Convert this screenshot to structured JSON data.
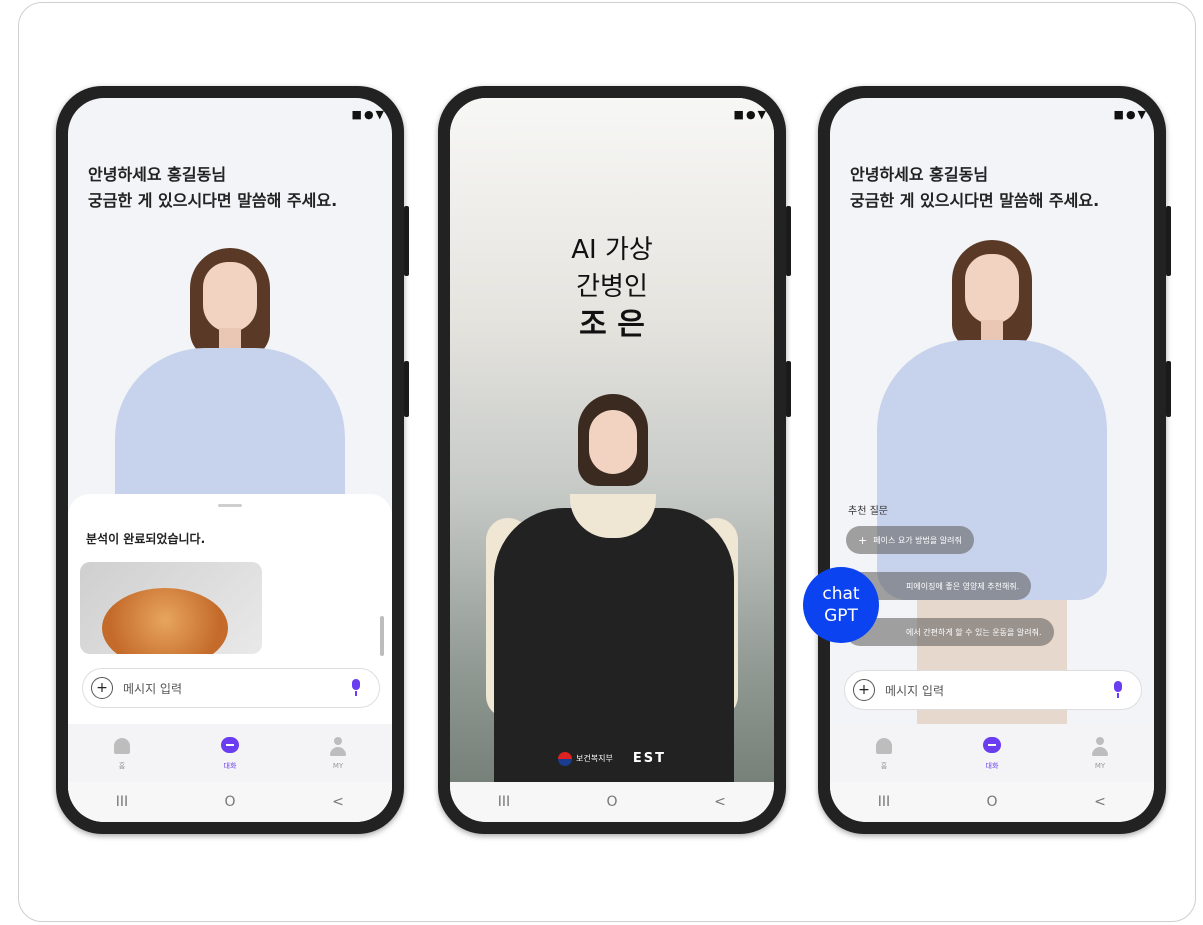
{
  "status_icons": "■●▼",
  "left_phone": {
    "greeting_line1": "안녕하세요 홍길동님",
    "greeting_line2": "궁금한 게 있으시다면 말씀해 주세요.",
    "sheet_title": "분석이 완료되었습니다.",
    "input_placeholder": "메시지 입력",
    "plus": "+",
    "tabs": [
      {
        "label": "홈",
        "icon": "home-icon"
      },
      {
        "label": "대화",
        "icon": "chat-icon",
        "active": true
      },
      {
        "label": "MY",
        "icon": "user-icon"
      }
    ],
    "nav": [
      "III",
      "O",
      "<"
    ]
  },
  "middle_phone": {
    "title_line1": "AI 가상",
    "title_line2": "간병인",
    "title_line3": "조 은",
    "gov_logo_text": "보건복지부",
    "est_logo_text": "EST",
    "nav": [
      "III",
      "O",
      "<"
    ]
  },
  "right_phone": {
    "greeting_line1": "안녕하세요 홍길동님",
    "greeting_line2": "궁금한 게 있으시다면 말씀해 주세요.",
    "suggest_title": "추천 질문",
    "chips": [
      "페이스 요가 방법을 알려줘",
      "피에이징에 좋은 영양제 추천해줘.",
      "에서 간편하게 할 수 있는 운동을 알려줘."
    ],
    "input_placeholder": "메시지 입력",
    "plus": "+",
    "tabs": [
      {
        "label": "홈",
        "icon": "home-icon"
      },
      {
        "label": "대화",
        "icon": "chat-icon",
        "active": true
      },
      {
        "label": "MY",
        "icon": "user-icon"
      }
    ],
    "nav": [
      "III",
      "O",
      "<"
    ]
  },
  "gpt_badge": {
    "line1": "chat",
    "line2": "GPT",
    "color": "#0b43f0"
  },
  "accent_color": "#6a3df0"
}
